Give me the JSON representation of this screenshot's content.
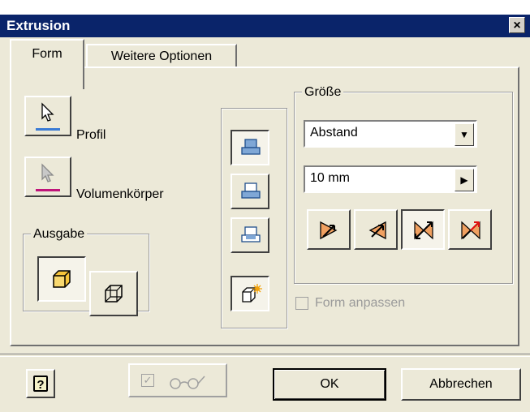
{
  "window": {
    "title": "Extrusion",
    "close_label": "×"
  },
  "tabs": [
    {
      "label": "Form",
      "active": true
    },
    {
      "label": "Weitere Optionen",
      "active": false
    }
  ],
  "profil": {
    "label": "Profil",
    "icon": "cursor-arrow-icon"
  },
  "volumen": {
    "label": "Volumenkörper",
    "icon": "cursor-arrow-gray-icon"
  },
  "ausgabe": {
    "title": "Ausgabe",
    "icons": [
      "solid-box-icon",
      "surface-box-icon"
    ]
  },
  "operation_icons": [
    "join-icon",
    "cut-icon",
    "intersect-icon",
    "new-solid-icon"
  ],
  "groesse": {
    "title": "Größe",
    "extent_value": "Abstand",
    "distance_value": "10 mm",
    "direction_icons": [
      "direction-1-icon",
      "direction-2-icon",
      "symmetric-icon",
      "asymmetric-icon"
    ]
  },
  "form_anpassen": {
    "label": "Form anpassen",
    "checked": false
  },
  "footer": {
    "help_label": "?",
    "ok_label": "OK",
    "cancel_label": "Abbrechen",
    "preview_icon": "glasses-icon"
  },
  "colors": {
    "title_bar": "#0a246a",
    "dialog_bg": "#ece9d8",
    "profile_underline": "#3a7bd5",
    "solid_underline": "#c0147a"
  }
}
